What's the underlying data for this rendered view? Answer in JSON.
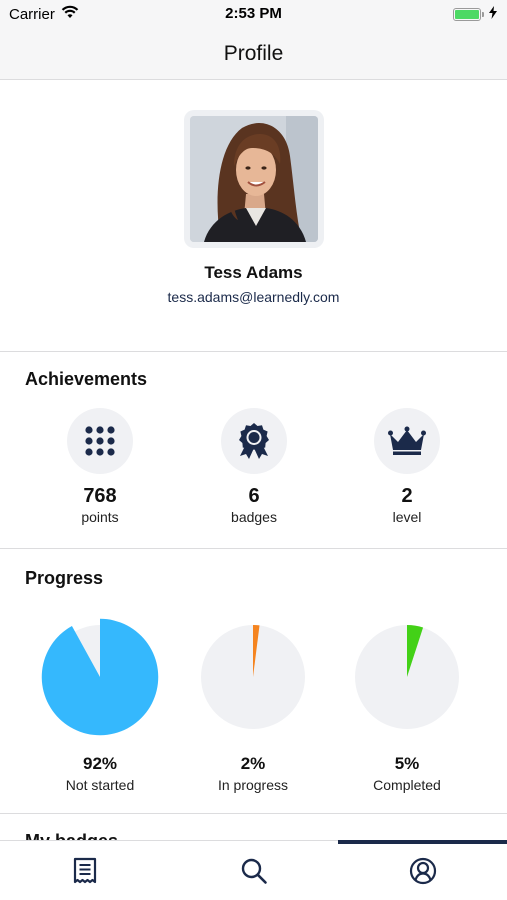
{
  "status_bar": {
    "carrier": "Carrier",
    "time": "2:53 PM",
    "wifi_icon": "wifi-icon",
    "battery_icon": "battery-icon",
    "charging_icon": "bolt-icon"
  },
  "nav": {
    "title": "Profile"
  },
  "profile": {
    "name": "Tess Adams",
    "email": "tess.adams@learnedly.com",
    "avatar_icon": "user-photo"
  },
  "achievements": {
    "title": "Achievements",
    "items": [
      {
        "icon": "grid-dots-icon",
        "value": "768",
        "label": "points"
      },
      {
        "icon": "badge-ribbon-icon",
        "value": "6",
        "label": "badges"
      },
      {
        "icon": "crown-icon",
        "value": "2",
        "label": "level"
      }
    ]
  },
  "progress": {
    "title": "Progress",
    "items": [
      {
        "value": "92%",
        "label": "Not started",
        "fraction": 0.92,
        "color": "#35b8fd"
      },
      {
        "value": "2%",
        "label": "In progress",
        "fraction": 0.02,
        "color": "#f5841f"
      },
      {
        "value": "5%",
        "label": "Completed",
        "fraction": 0.05,
        "color": "#43d117"
      }
    ]
  },
  "badges_section": {
    "title": "My badges"
  },
  "tab_bar": {
    "tabs": [
      {
        "icon": "receipt-icon",
        "active": false
      },
      {
        "icon": "search-icon",
        "active": false
      },
      {
        "icon": "profile-icon",
        "active": true
      }
    ]
  },
  "colors": {
    "accent": "#1b2a4a",
    "background": "#ffffff",
    "nav_background": "#f6f6f7",
    "icon_circle": "#f0f1f4"
  }
}
